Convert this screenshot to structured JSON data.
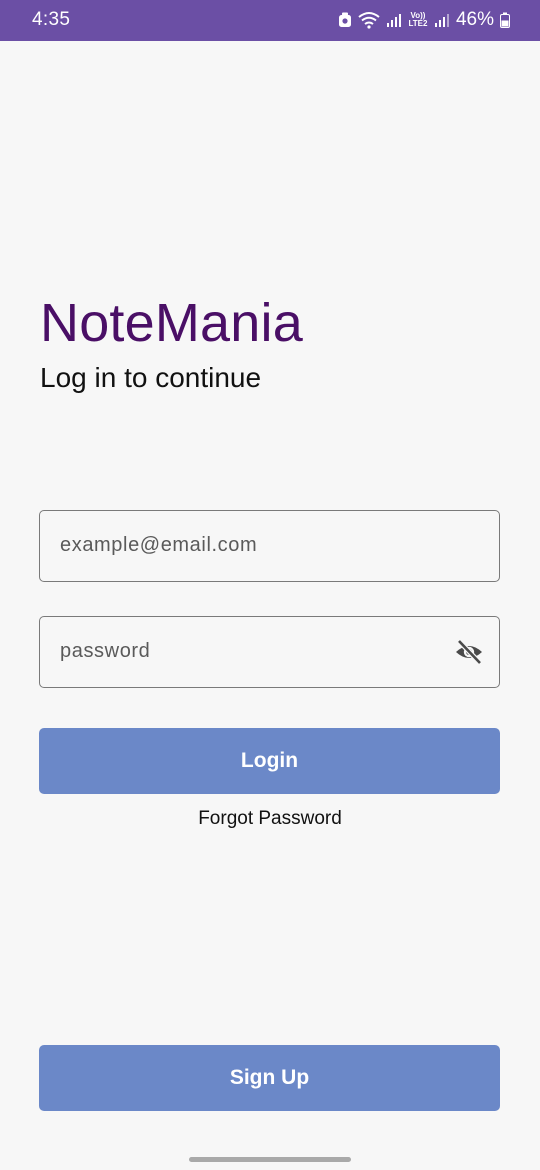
{
  "status_bar": {
    "time": "4:35",
    "volte_label": "Vo)) LTE2",
    "battery_percent": "46%",
    "background_color": "#6b4fa5"
  },
  "app": {
    "title": "NoteMania",
    "subtitle": "Log in to continue",
    "title_color": "#4a0f66"
  },
  "form": {
    "email_placeholder": "example@email.com",
    "email_value": "",
    "password_placeholder": "password",
    "password_value": "",
    "password_toggle_icon": "eye-off-icon",
    "login_label": "Login",
    "forgot_label": "Forgot Password",
    "signup_label": "Sign Up",
    "button_color": "#6b88c8"
  }
}
